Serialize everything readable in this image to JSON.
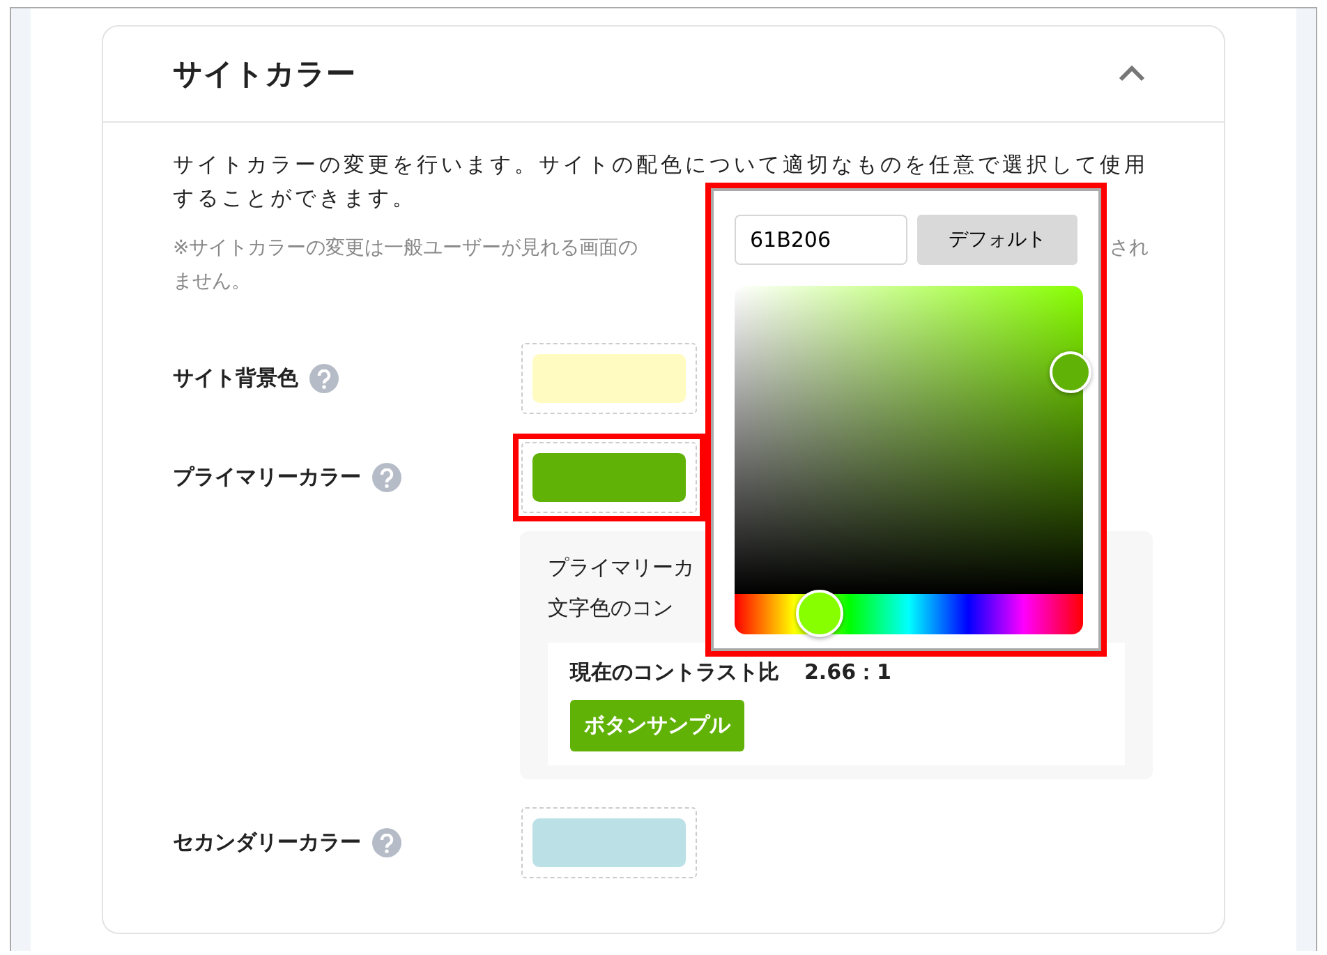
{
  "section": {
    "title": "サイトカラー",
    "expanded": true
  },
  "description": "サイトカラーの変更を行います。サイトの配色について適切なものを任意で選択して使用することができます。",
  "note": {
    "line_1_visible": "※サイトカラーの変更は一般ユーザーが見れる画面の",
    "line_1_end": "され",
    "line_2": "ません。"
  },
  "fields": [
    {
      "label": "サイト背景色",
      "color": "#fffbc1"
    },
    {
      "label": "プライマリーカラー",
      "color": "#61b206",
      "highlighted": true
    },
    {
      "label": "セカンダリーカラー",
      "color": "#bbe0e6"
    }
  ],
  "contrast": {
    "line_1": "プライマリーカ",
    "line_2": "文字色のコン",
    "ratio_label": "現在のコントラスト比",
    "ratio_value": "2.66：1",
    "sample_button": "ボタンサンプル"
  },
  "picker": {
    "hex": "61B206",
    "default_button": "デフォルト",
    "hue": {
      "level": 0.245
    },
    "highlighted": true
  }
}
